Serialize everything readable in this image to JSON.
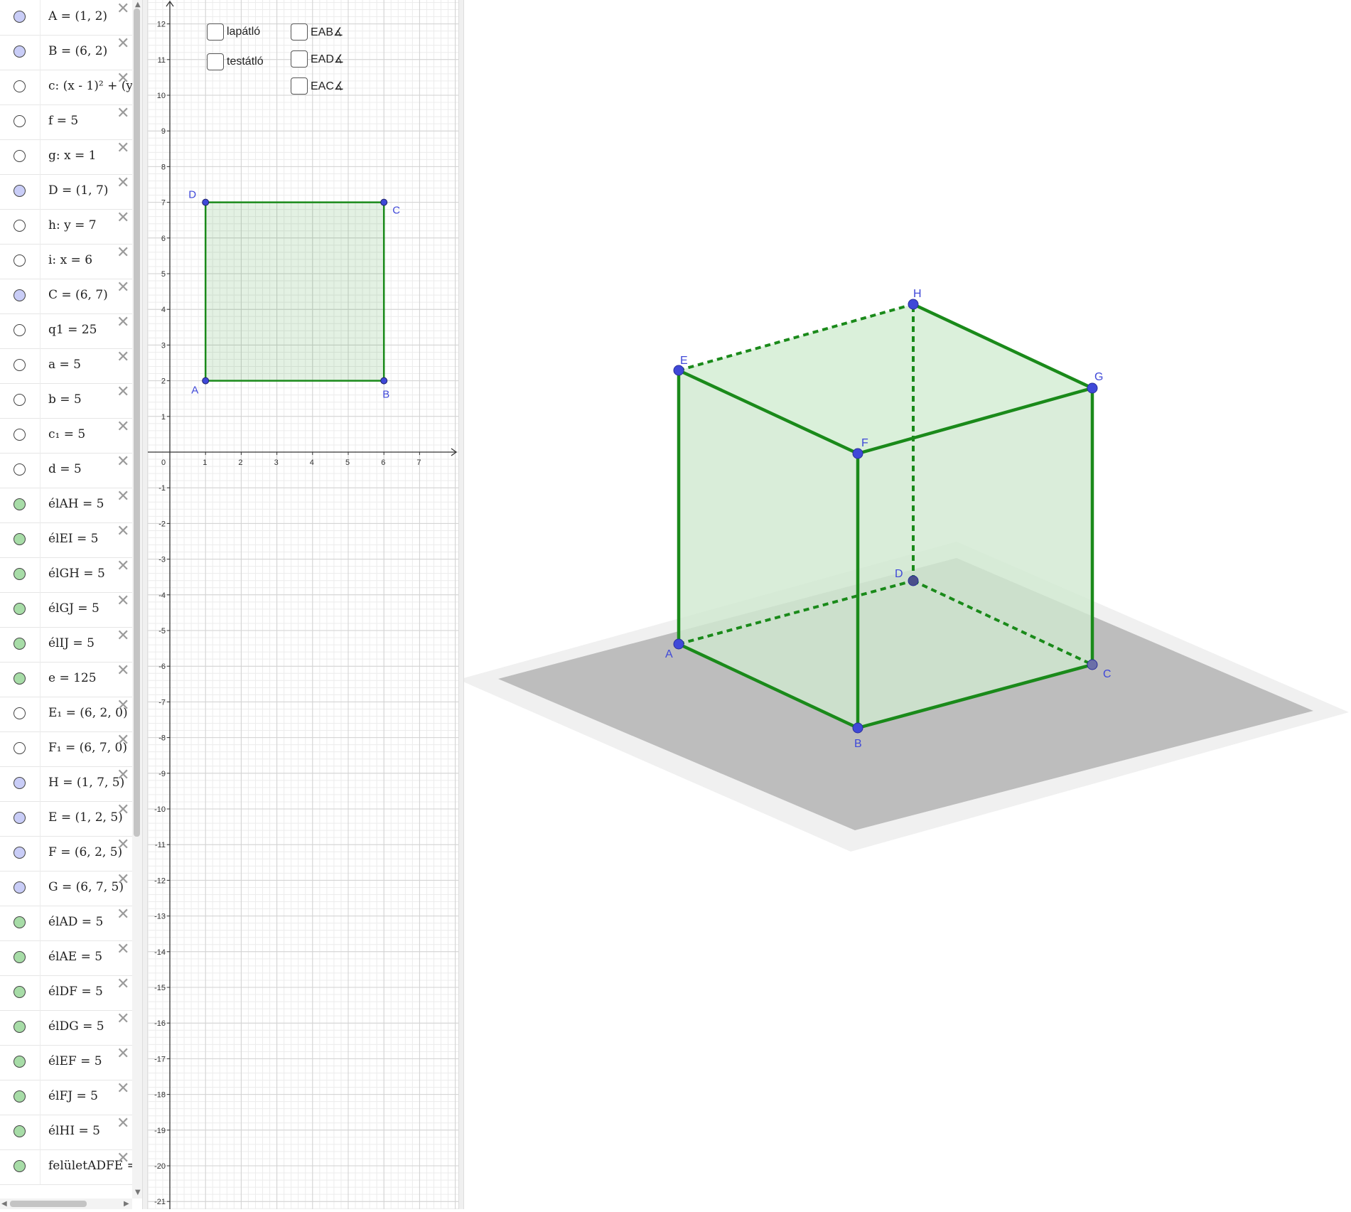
{
  "algebra": {
    "items": [
      {
        "text": "A = (1, 2)",
        "fill": "#c9cdf7",
        "closable": true
      },
      {
        "text": "B = (6, 2)",
        "fill": "#c9cdf7",
        "closable": true
      },
      {
        "text": "c: (x - 1)² + (y",
        "fill": "#ffffff",
        "closable": true
      },
      {
        "text": "f = 5",
        "fill": "#ffffff",
        "closable": true
      },
      {
        "text": "g: x = 1",
        "fill": "#ffffff",
        "closable": true
      },
      {
        "text": "D = (1, 7)",
        "fill": "#c9cdf7",
        "closable": true
      },
      {
        "text": "h: y = 7",
        "fill": "#ffffff",
        "closable": true
      },
      {
        "text": "i: x = 6",
        "fill": "#ffffff",
        "closable": true
      },
      {
        "text": "C = (6, 7)",
        "fill": "#c9cdf7",
        "closable": true
      },
      {
        "text": "q1 = 25",
        "fill": "#ffffff",
        "closable": true
      },
      {
        "text": "a = 5",
        "fill": "#ffffff",
        "closable": true
      },
      {
        "text": "b = 5",
        "fill": "#ffffff",
        "closable": true
      },
      {
        "text": "c₁ = 5",
        "fill": "#ffffff",
        "closable": true
      },
      {
        "text": "d = 5",
        "fill": "#ffffff",
        "closable": true
      },
      {
        "text": "élAH = 5",
        "fill": "#a7dca7",
        "closable": true
      },
      {
        "text": "élEI = 5",
        "fill": "#a7dca7",
        "closable": true
      },
      {
        "text": "élGH = 5",
        "fill": "#a7dca7",
        "closable": true
      },
      {
        "text": "élGJ = 5",
        "fill": "#a7dca7",
        "closable": true
      },
      {
        "text": "élIJ = 5",
        "fill": "#a7dca7",
        "closable": true
      },
      {
        "text": "e = 125",
        "fill": "#a7dca7",
        "closable": true
      },
      {
        "text": "E₁ = (6, 2, 0)",
        "fill": "#ffffff",
        "closable": true
      },
      {
        "text": "F₁ = (6, 7, 0)",
        "fill": "#ffffff",
        "closable": true
      },
      {
        "text": "H = (1, 7, 5)",
        "fill": "#c9cdf7",
        "closable": true
      },
      {
        "text": "E = (1, 2, 5)",
        "fill": "#c9cdf7",
        "closable": true
      },
      {
        "text": "F = (6, 2, 5)",
        "fill": "#c9cdf7",
        "closable": true
      },
      {
        "text": "G = (6, 7, 5)",
        "fill": "#c9cdf7",
        "closable": true
      },
      {
        "text": "élAD = 5",
        "fill": "#a7dca7",
        "closable": true
      },
      {
        "text": "élAE = 5",
        "fill": "#a7dca7",
        "closable": true
      },
      {
        "text": "élDF = 5",
        "fill": "#a7dca7",
        "closable": true
      },
      {
        "text": "élDG = 5",
        "fill": "#a7dca7",
        "closable": true
      },
      {
        "text": "élEF = 5",
        "fill": "#a7dca7",
        "closable": true
      },
      {
        "text": "élFJ = 5",
        "fill": "#a7dca7",
        "closable": true
      },
      {
        "text": "élHI = 5",
        "fill": "#a7dca7",
        "closable": true
      },
      {
        "text": "felületADFE =",
        "fill": "#a7dca7",
        "closable": true
      }
    ],
    "delete_glyph": "✕"
  },
  "checkboxes": {
    "lapatlo": "lapátló",
    "testatlo": "testátló",
    "eab": "EAB∡",
    "ead": "EAD∡",
    "eac": "EAC∡"
  },
  "graphics2d": {
    "x_ticks": [
      0,
      1,
      2,
      3,
      4,
      5,
      6,
      7
    ],
    "y_ticks": [
      12,
      11,
      10,
      9,
      8,
      7,
      6,
      5,
      4,
      3,
      2,
      1,
      -1,
      -2,
      -3,
      -4,
      -5,
      -6,
      -7,
      -8,
      -9,
      -10,
      -11,
      -12,
      -13,
      -14,
      -15,
      -16,
      -17,
      -18,
      -19,
      -20,
      -21
    ],
    "points": [
      {
        "name": "A",
        "x": 1,
        "y": 2
      },
      {
        "name": "B",
        "x": 6,
        "y": 2
      },
      {
        "name": "C",
        "x": 6,
        "y": 7
      },
      {
        "name": "D",
        "x": 1,
        "y": 7
      }
    ],
    "polygon_color": "#1a8a1a",
    "point_color": "#3f48d8"
  },
  "graphics3d": {
    "vertices": [
      "A",
      "B",
      "C",
      "D",
      "E",
      "F",
      "G",
      "H"
    ],
    "edge_color": "#1a8a1a",
    "point_color": "#3f48d8"
  },
  "colors": {
    "label_blue": "#3f48d8",
    "green": "#1a8a1a"
  }
}
